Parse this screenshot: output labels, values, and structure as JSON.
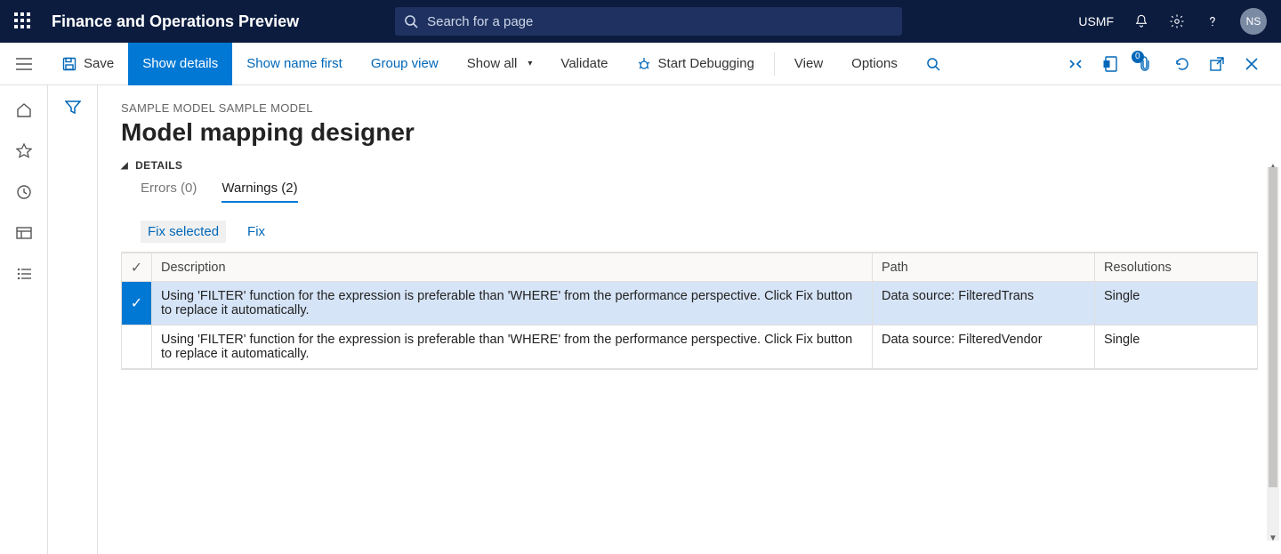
{
  "topbar": {
    "brand": "Finance and Operations Preview",
    "search_placeholder": "Search for a page",
    "company": "USMF",
    "avatar_initials": "NS"
  },
  "cmdbar": {
    "save": "Save",
    "show_details": "Show details",
    "show_name_first": "Show name first",
    "group_view": "Group view",
    "show_all": "Show all",
    "validate": "Validate",
    "start_debugging": "Start Debugging",
    "view": "View",
    "options": "Options",
    "attach_badge": "0"
  },
  "page": {
    "breadcrumb": "SAMPLE MODEL SAMPLE MODEL",
    "title": "Model mapping designer",
    "section": "DETAILS"
  },
  "tabs": {
    "errors": "Errors (0)",
    "warnings": "Warnings (2)"
  },
  "actions": {
    "fix_selected": "Fix selected",
    "fix": "Fix"
  },
  "table": {
    "headers": {
      "description": "Description",
      "path": "Path",
      "resolutions": "Resolutions"
    },
    "rows": [
      {
        "selected": true,
        "description": "Using 'FILTER' function for the expression is preferable than 'WHERE' from the performance perspective. Click Fix button to replace it automatically.",
        "path": "Data source: FilteredTrans",
        "resolutions": "Single"
      },
      {
        "selected": false,
        "description": "Using 'FILTER' function for the expression is preferable than 'WHERE' from the performance perspective. Click Fix button to replace it automatically.",
        "path": "Data source: FilteredVendor",
        "resolutions": "Single"
      }
    ]
  }
}
